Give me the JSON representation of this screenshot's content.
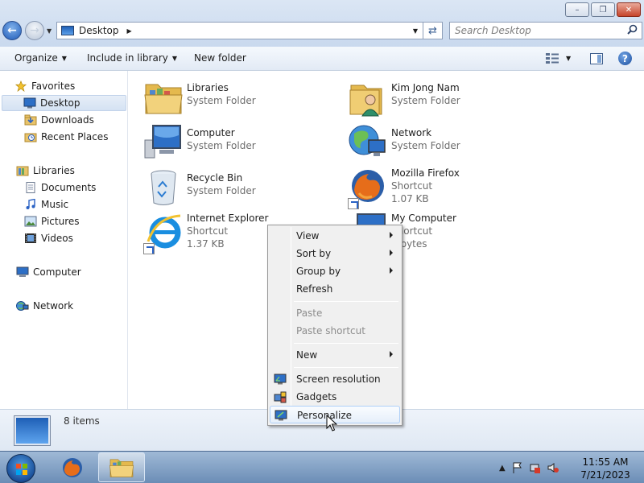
{
  "window": {
    "controls": {
      "minimize": "–",
      "maximize": "❐",
      "close": "✕"
    }
  },
  "nav": {
    "back_icon": "arrow-left-icon",
    "forward_icon": "arrow-right-icon",
    "address": {
      "location": "Desktop"
    },
    "search_placeholder": "Search Desktop"
  },
  "toolbar": {
    "organize": "Organize",
    "include_in_library": "Include in library",
    "new_folder": "New folder"
  },
  "sidebar": {
    "favorites": {
      "label": "Favorites",
      "items": [
        {
          "label": "Desktop",
          "selected": true
        },
        {
          "label": "Downloads"
        },
        {
          "label": "Recent Places"
        }
      ]
    },
    "libraries": {
      "label": "Libraries",
      "items": [
        {
          "label": "Documents"
        },
        {
          "label": "Music"
        },
        {
          "label": "Pictures"
        },
        {
          "label": "Videos"
        }
      ]
    },
    "computer": {
      "label": "Computer"
    },
    "network": {
      "label": "Network"
    }
  },
  "items": [
    {
      "name": "Libraries",
      "type": "System Folder"
    },
    {
      "name": "Kim Jong Nam",
      "type": "System Folder"
    },
    {
      "name": "Computer",
      "type": "System Folder"
    },
    {
      "name": "Network",
      "type": "System Folder"
    },
    {
      "name": "Recycle Bin",
      "type": "System Folder"
    },
    {
      "name": "Mozilla Firefox",
      "type": "Shortcut",
      "size": "1.07 KB"
    },
    {
      "name": "Internet Explorer",
      "type": "Shortcut",
      "size": "1.37 KB"
    },
    {
      "name": "My Computer",
      "type": "Shortcut",
      "size": "5 bytes"
    }
  ],
  "details": {
    "count": "8 items"
  },
  "context_menu": {
    "view": "View",
    "sort_by": "Sort by",
    "group_by": "Group by",
    "refresh": "Refresh",
    "paste": "Paste",
    "paste_shortcut": "Paste shortcut",
    "new": "New",
    "screen_resolution": "Screen resolution",
    "gadgets": "Gadgets",
    "personalize": "Personalize"
  },
  "taskbar": {
    "time": "11:55 AM",
    "date": "7/21/2023"
  },
  "colors": {
    "accent": "#1f5bb8",
    "titlebar": "#c9d9ee",
    "close": "#c7442a",
    "taskbar": "#6b8db6"
  }
}
